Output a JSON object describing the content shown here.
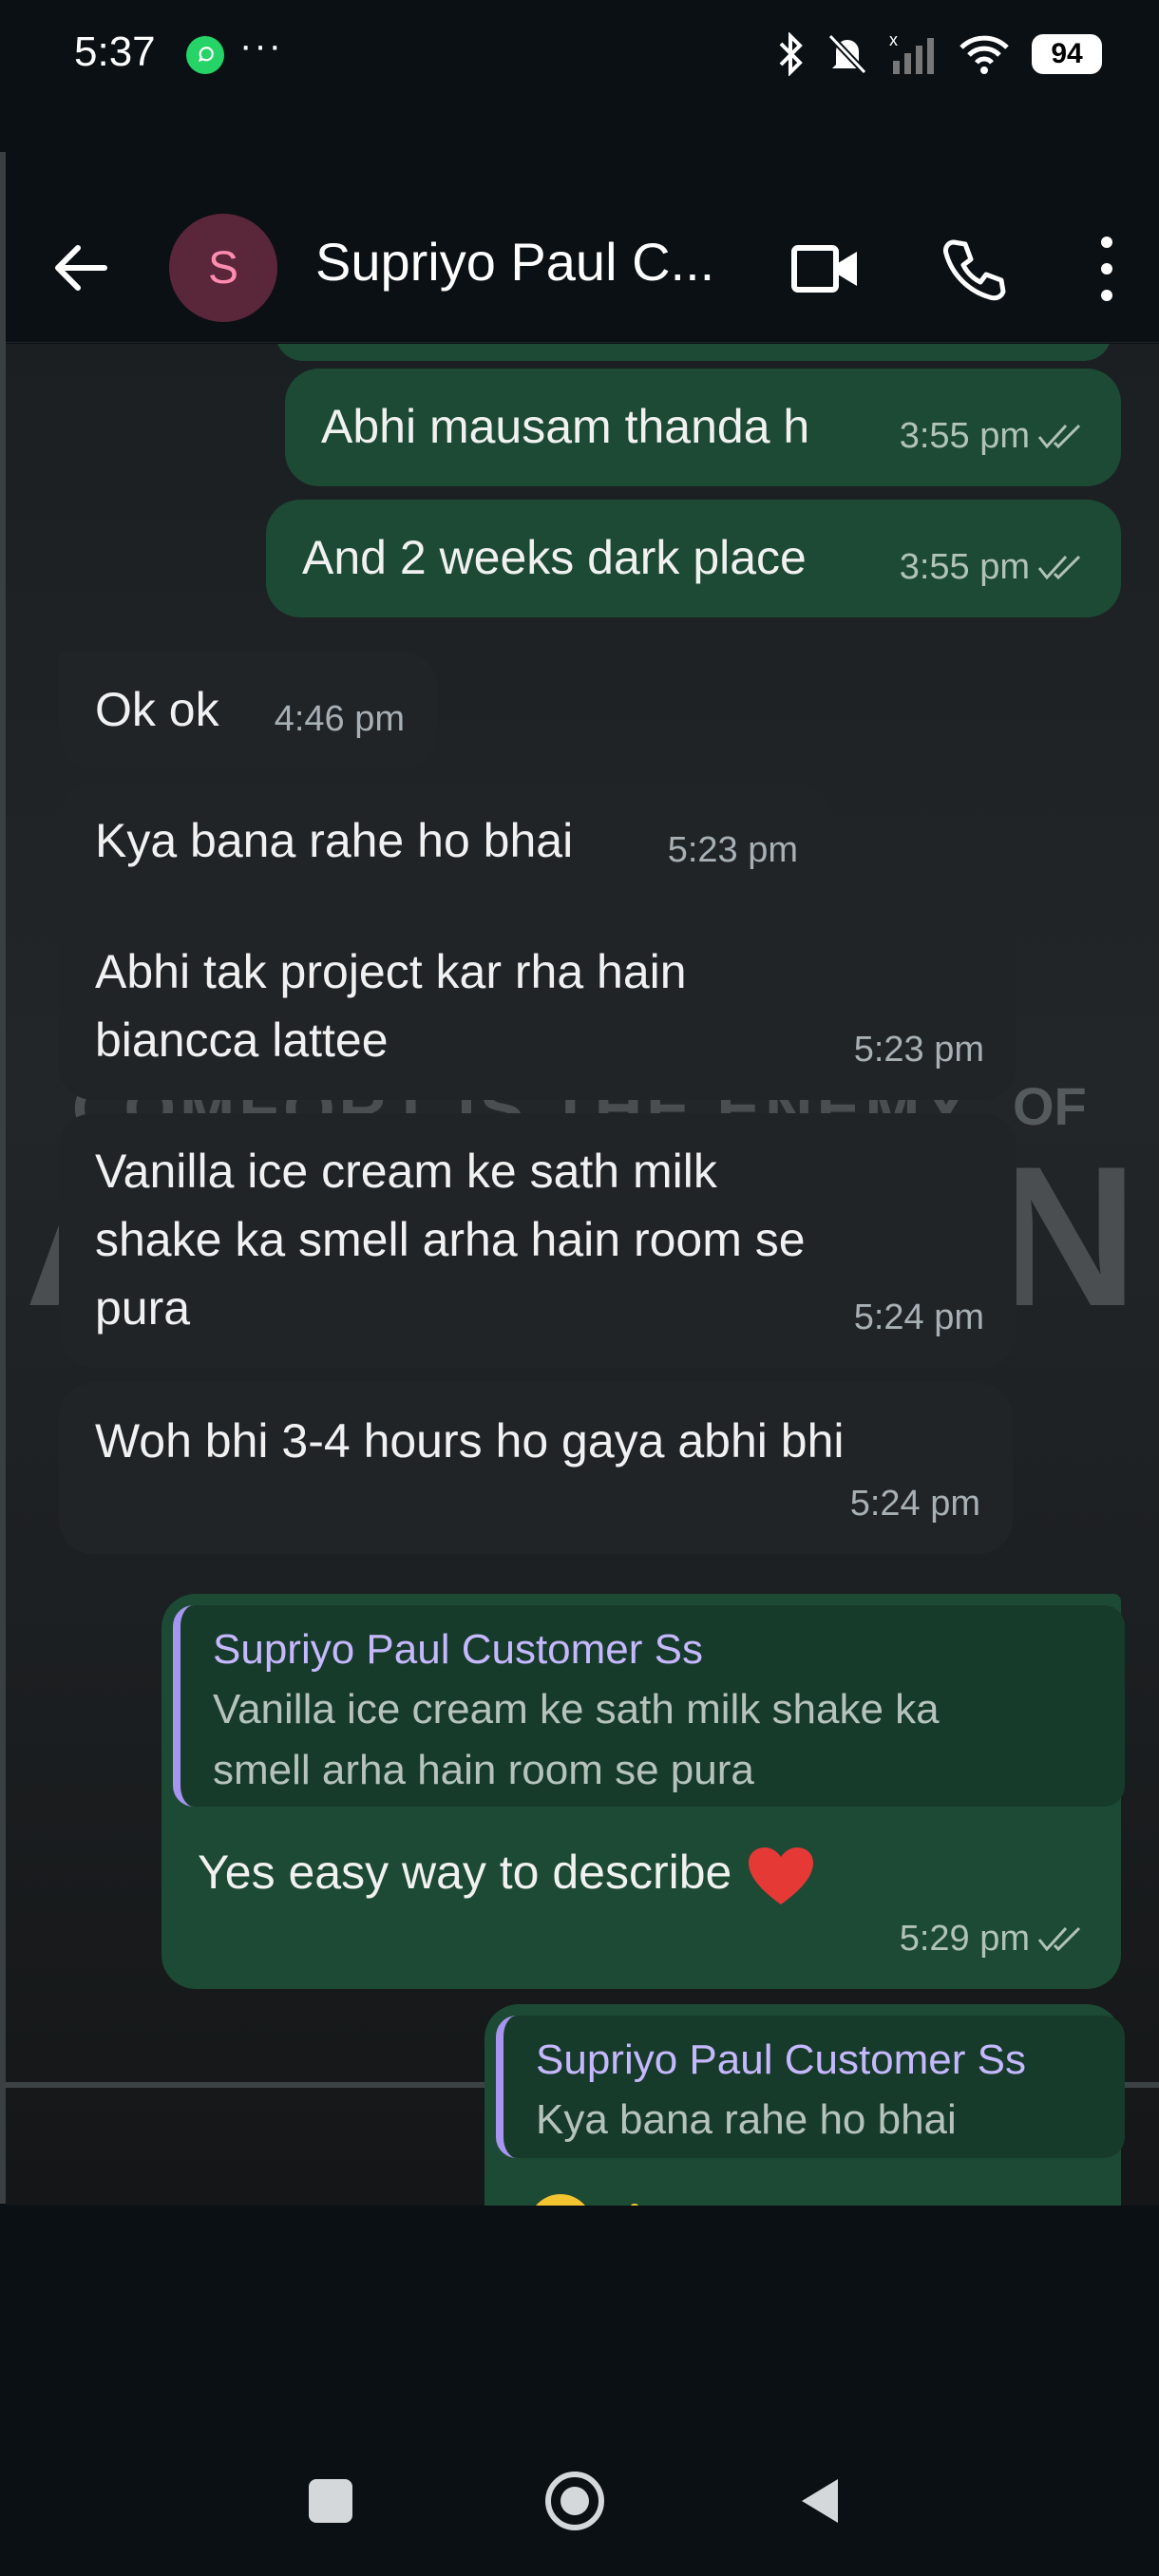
{
  "status_bar": {
    "time": "5:37",
    "more": "···",
    "battery": "94"
  },
  "header": {
    "avatar_letter": "S",
    "contact_name": "Supriyo Paul C..."
  },
  "background_text": {
    "line1": "COMFORT IS THE ENEMY",
    "of": "OF",
    "big_left": "A",
    "big_right": "N"
  },
  "messages": [
    {
      "text": "Abhi mausam thanda h",
      "time": "3:55 pm"
    },
    {
      "text": "And 2 weeks dark place",
      "time": "3:55 pm"
    },
    {
      "text": "Ok ok",
      "time": "4:46 pm"
    },
    {
      "text": "Kya bana rahe ho bhai",
      "time": "5:23 pm"
    },
    {
      "line1": "Abhi tak project kar rha hain",
      "line2": "biancca lattee",
      "time": "5:23 pm"
    },
    {
      "line1": "Vanilla ice cream ke sath milk",
      "line2": "shake ka smell arha hain room se",
      "line3": "pura",
      "time": "5:24 pm"
    },
    {
      "text": "Woh bhi 3-4 hours ho gaya abhi bhi",
      "time": "5:24 pm"
    },
    {
      "quote_name": "Supriyo Paul Customer Ss",
      "quote_line1": "Vanilla ice cream ke sath milk shake ka",
      "quote_line2": "smell arha hain room se pura",
      "text": "Yes easy way to describe",
      "time": "5:29 pm"
    },
    {
      "quote_name": "Supriyo Paul Customer Ss",
      "quote_text": "Kya bana rahe ho bhai"
    }
  ],
  "colors": {
    "outgoing": "#1d4a34",
    "incoming": "#212427",
    "quote_bar": "#a795f0",
    "heart": "#e53935"
  }
}
